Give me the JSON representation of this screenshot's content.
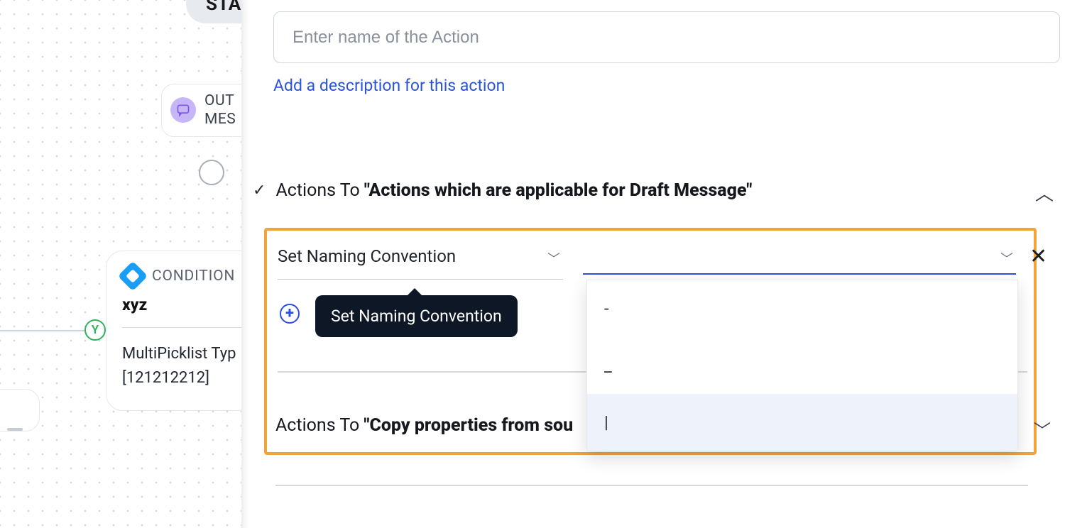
{
  "canvas": {
    "start_label": "STA",
    "outbound": {
      "line1": "OUT",
      "line2": "MES"
    },
    "y_badge": "Y",
    "condition": {
      "label": "CONDITION",
      "name": "xyz",
      "body_line1": "MultiPicklist Typ",
      "body_line2": "[121212212]"
    }
  },
  "panel": {
    "action_name_placeholder": "Enter name of the Action",
    "add_description": "Add a description for this action",
    "section1": {
      "prefix": "Actions To ",
      "quoted": "\"Actions which are applicable for Draft Message\""
    },
    "action_select": "Set Naming Convention",
    "tooltip": "Set Naming Convention",
    "section2": {
      "prefix": "Actions To ",
      "quoted": "\"Copy properties from sou"
    },
    "dropdown": {
      "opt1": "-",
      "opt2": "_",
      "opt3": "|"
    }
  }
}
